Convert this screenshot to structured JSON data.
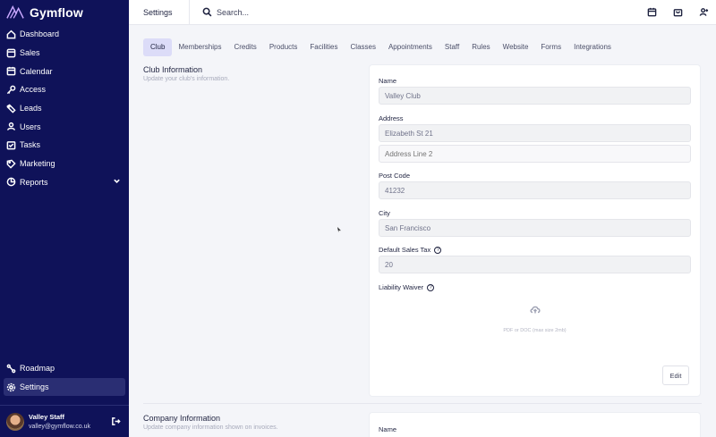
{
  "brand": {
    "name": "Gymflow"
  },
  "sidebar": {
    "items": [
      {
        "label": "Dashboard",
        "icon": "home-icon"
      },
      {
        "label": "Sales",
        "icon": "card-icon"
      },
      {
        "label": "Calendar",
        "icon": "calendar-icon"
      },
      {
        "label": "Access",
        "icon": "key-icon"
      },
      {
        "label": "Leads",
        "icon": "tag-icon"
      },
      {
        "label": "Users",
        "icon": "users-icon"
      },
      {
        "label": "Tasks",
        "icon": "tasks-icon"
      },
      {
        "label": "Marketing",
        "icon": "marketing-icon"
      },
      {
        "label": "Reports",
        "icon": "reports-icon"
      }
    ],
    "bottom": [
      {
        "label": "Roadmap",
        "icon": "roadmap-icon"
      },
      {
        "label": "Settings",
        "icon": "gear-icon",
        "active": true
      }
    ],
    "user": {
      "name": "Valley Staff",
      "email": "valley@gymflow.co.uk"
    }
  },
  "topbar": {
    "title": "Settings",
    "search_placeholder": "Search..."
  },
  "tabs": [
    "Club",
    "Memberships",
    "Credits",
    "Products",
    "Facilities",
    "Classes",
    "Appointments",
    "Staff",
    "Rules",
    "Website",
    "Forms",
    "Integrations"
  ],
  "active_tab": "Club",
  "club_info": {
    "title": "Club Information",
    "subtitle": "Update your club's information.",
    "name_label": "Name",
    "name_value": "Valley Club",
    "address_label": "Address",
    "address_line1": "Elizabeth St 21",
    "address_line2_placeholder": "Address Line 2",
    "postcode_label": "Post Code",
    "postcode_value": "41232",
    "city_label": "City",
    "city_value": "San Francisco",
    "tax_label": "Default Sales Tax",
    "tax_value": "20",
    "waiver_label": "Liability Waiver",
    "upload_hint": "PDF or DOC (max size 2mb)",
    "edit_label": "Edit"
  },
  "company_info": {
    "title": "Company Information",
    "subtitle": "Update company information shown on invoices.",
    "name_label": "Name"
  },
  "colors": {
    "sidebar": "#0f1259",
    "accent_tab": "#dcdcf8"
  }
}
